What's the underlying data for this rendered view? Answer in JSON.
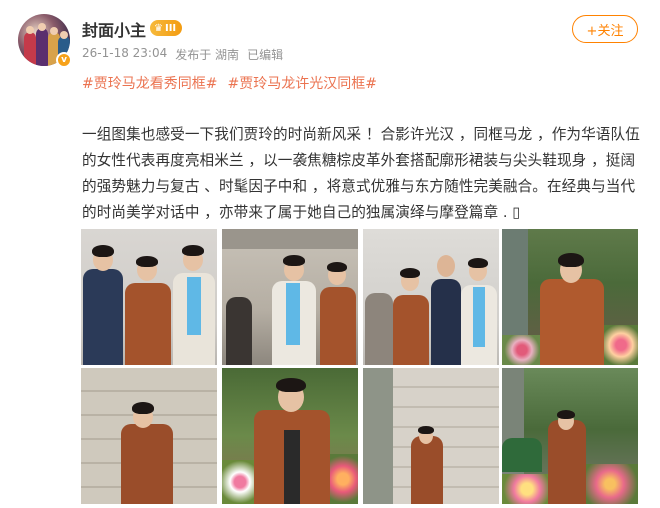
{
  "header": {
    "username": "封面小主",
    "vip_label": "III",
    "avatar_badge": "v",
    "timestamp": "26-1-18 23:04",
    "source": "发布于 湖南",
    "edited": "已编辑",
    "follow_label": "+关注"
  },
  "topics": [
    "#贾玲马龙看秀同框#",
    "#贾玲马龙许光汉同框#"
  ],
  "content": {
    "text": "一组图集也感受一下我们贾玲的时尚新风采 ！合影许光汉 ，同框马龙 ，作为华语队伍的女性代表再度亮相米兰 ，以一袭焦糖棕皮革外套搭配廓形裙装与尖头鞋现身 ，挺阔的强势魅力与复古 、时髦因子中和 ，将意式优雅与东方随性完美融合。在经典与当代的时尚美学对话中 ，亦带来了属于她自己的独属演绎与摩登篇章 .  ▯"
  },
  "images": [
    {
      "name": "group-photo-three-people"
    },
    {
      "name": "photo-two-people-indoor"
    },
    {
      "name": "group-photo-four-people"
    },
    {
      "name": "photo-woman-flowers"
    },
    {
      "name": "photo-woman-stone-wall"
    },
    {
      "name": "photo-woman-smiling-flowers"
    },
    {
      "name": "photo-woman-walking-building"
    },
    {
      "name": "photo-woman-street-flowers"
    }
  ],
  "colors": {
    "accent": "#ff8200",
    "topic": "#eb7350",
    "meta": "#939393",
    "jacket": "#9a4d2a"
  }
}
